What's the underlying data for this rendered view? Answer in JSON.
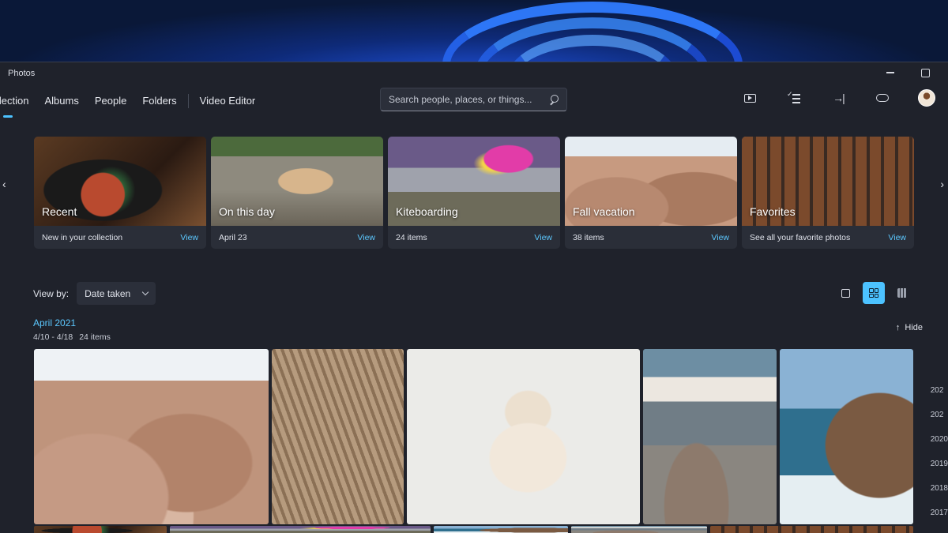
{
  "window": {
    "title": "Photos"
  },
  "nav": {
    "tabs": [
      {
        "label": "llection",
        "active": true
      },
      {
        "label": "Albums"
      },
      {
        "label": "People"
      },
      {
        "label": "Folders"
      }
    ],
    "video_editor": "Video Editor"
  },
  "search": {
    "placeholder": "Search people, places, or things..."
  },
  "toolbar": {
    "icons": [
      "slideshow-icon",
      "select-icon",
      "import-icon",
      "onedrive-icon",
      "avatar"
    ]
  },
  "memories": [
    {
      "title": "Recent",
      "subtitle": "New in your collection",
      "action": "View"
    },
    {
      "title": "On this day",
      "subtitle": "April 23",
      "action": "View"
    },
    {
      "title": "Kiteboarding",
      "subtitle": "24 items",
      "action": "View"
    },
    {
      "title": "Fall vacation",
      "subtitle": "38 items",
      "action": "View"
    },
    {
      "title": "Favorites",
      "subtitle": "See all your favorite photos",
      "action": "View"
    }
  ],
  "hide_label": "Hide",
  "view_by": {
    "label": "View by:",
    "value": "Date taken"
  },
  "group": {
    "month": "April 2021",
    "range": "4/10 - 4/18",
    "count": "24 items"
  },
  "scrubber": [
    "202",
    "202",
    "2020",
    "2019",
    "2018",
    "2017"
  ],
  "colors": {
    "accent": "#4cc2ff",
    "window_bg": "#1f222b",
    "card_bg": "#2a2e38"
  }
}
